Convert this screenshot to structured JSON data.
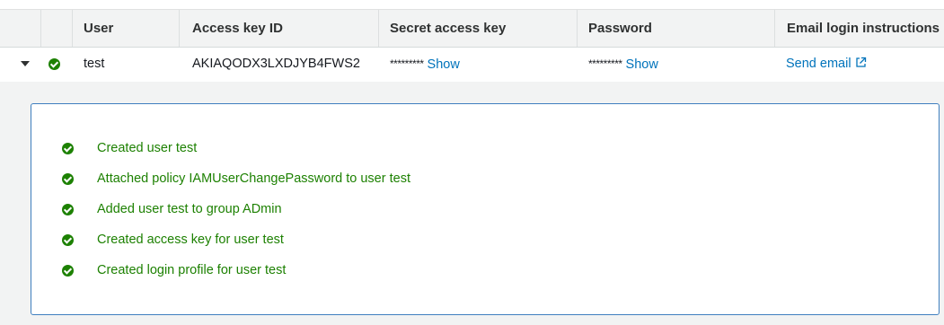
{
  "table": {
    "columns": {
      "user": "User",
      "access_key_id": "Access key ID",
      "secret_access_key": "Secret access key",
      "password": "Password",
      "email_login_instructions": "Email login instructions"
    },
    "rows": [
      {
        "user": "test",
        "access_key_id": "AKIAQODX3LXDJYB4FWS2",
        "secret_mask": "*********",
        "secret_show": "Show",
        "password_mask": "*********",
        "password_show": "Show",
        "email_link": "Send email"
      }
    ]
  },
  "details": {
    "messages": [
      "Created user test",
      "Attached policy IAMUserChangePassword to user test",
      "Added user test to group ADmin",
      "Created access key for user test",
      "Created login profile for user test"
    ]
  },
  "icons": {
    "expand": "chevron-down-icon",
    "success": "check-circle-icon",
    "external_link": "external-link-icon"
  },
  "colors": {
    "success_green": "#1d8102",
    "link_blue": "#0073bb",
    "header_bg": "#f2f3f3",
    "panel_border": "#3f7fbf"
  }
}
